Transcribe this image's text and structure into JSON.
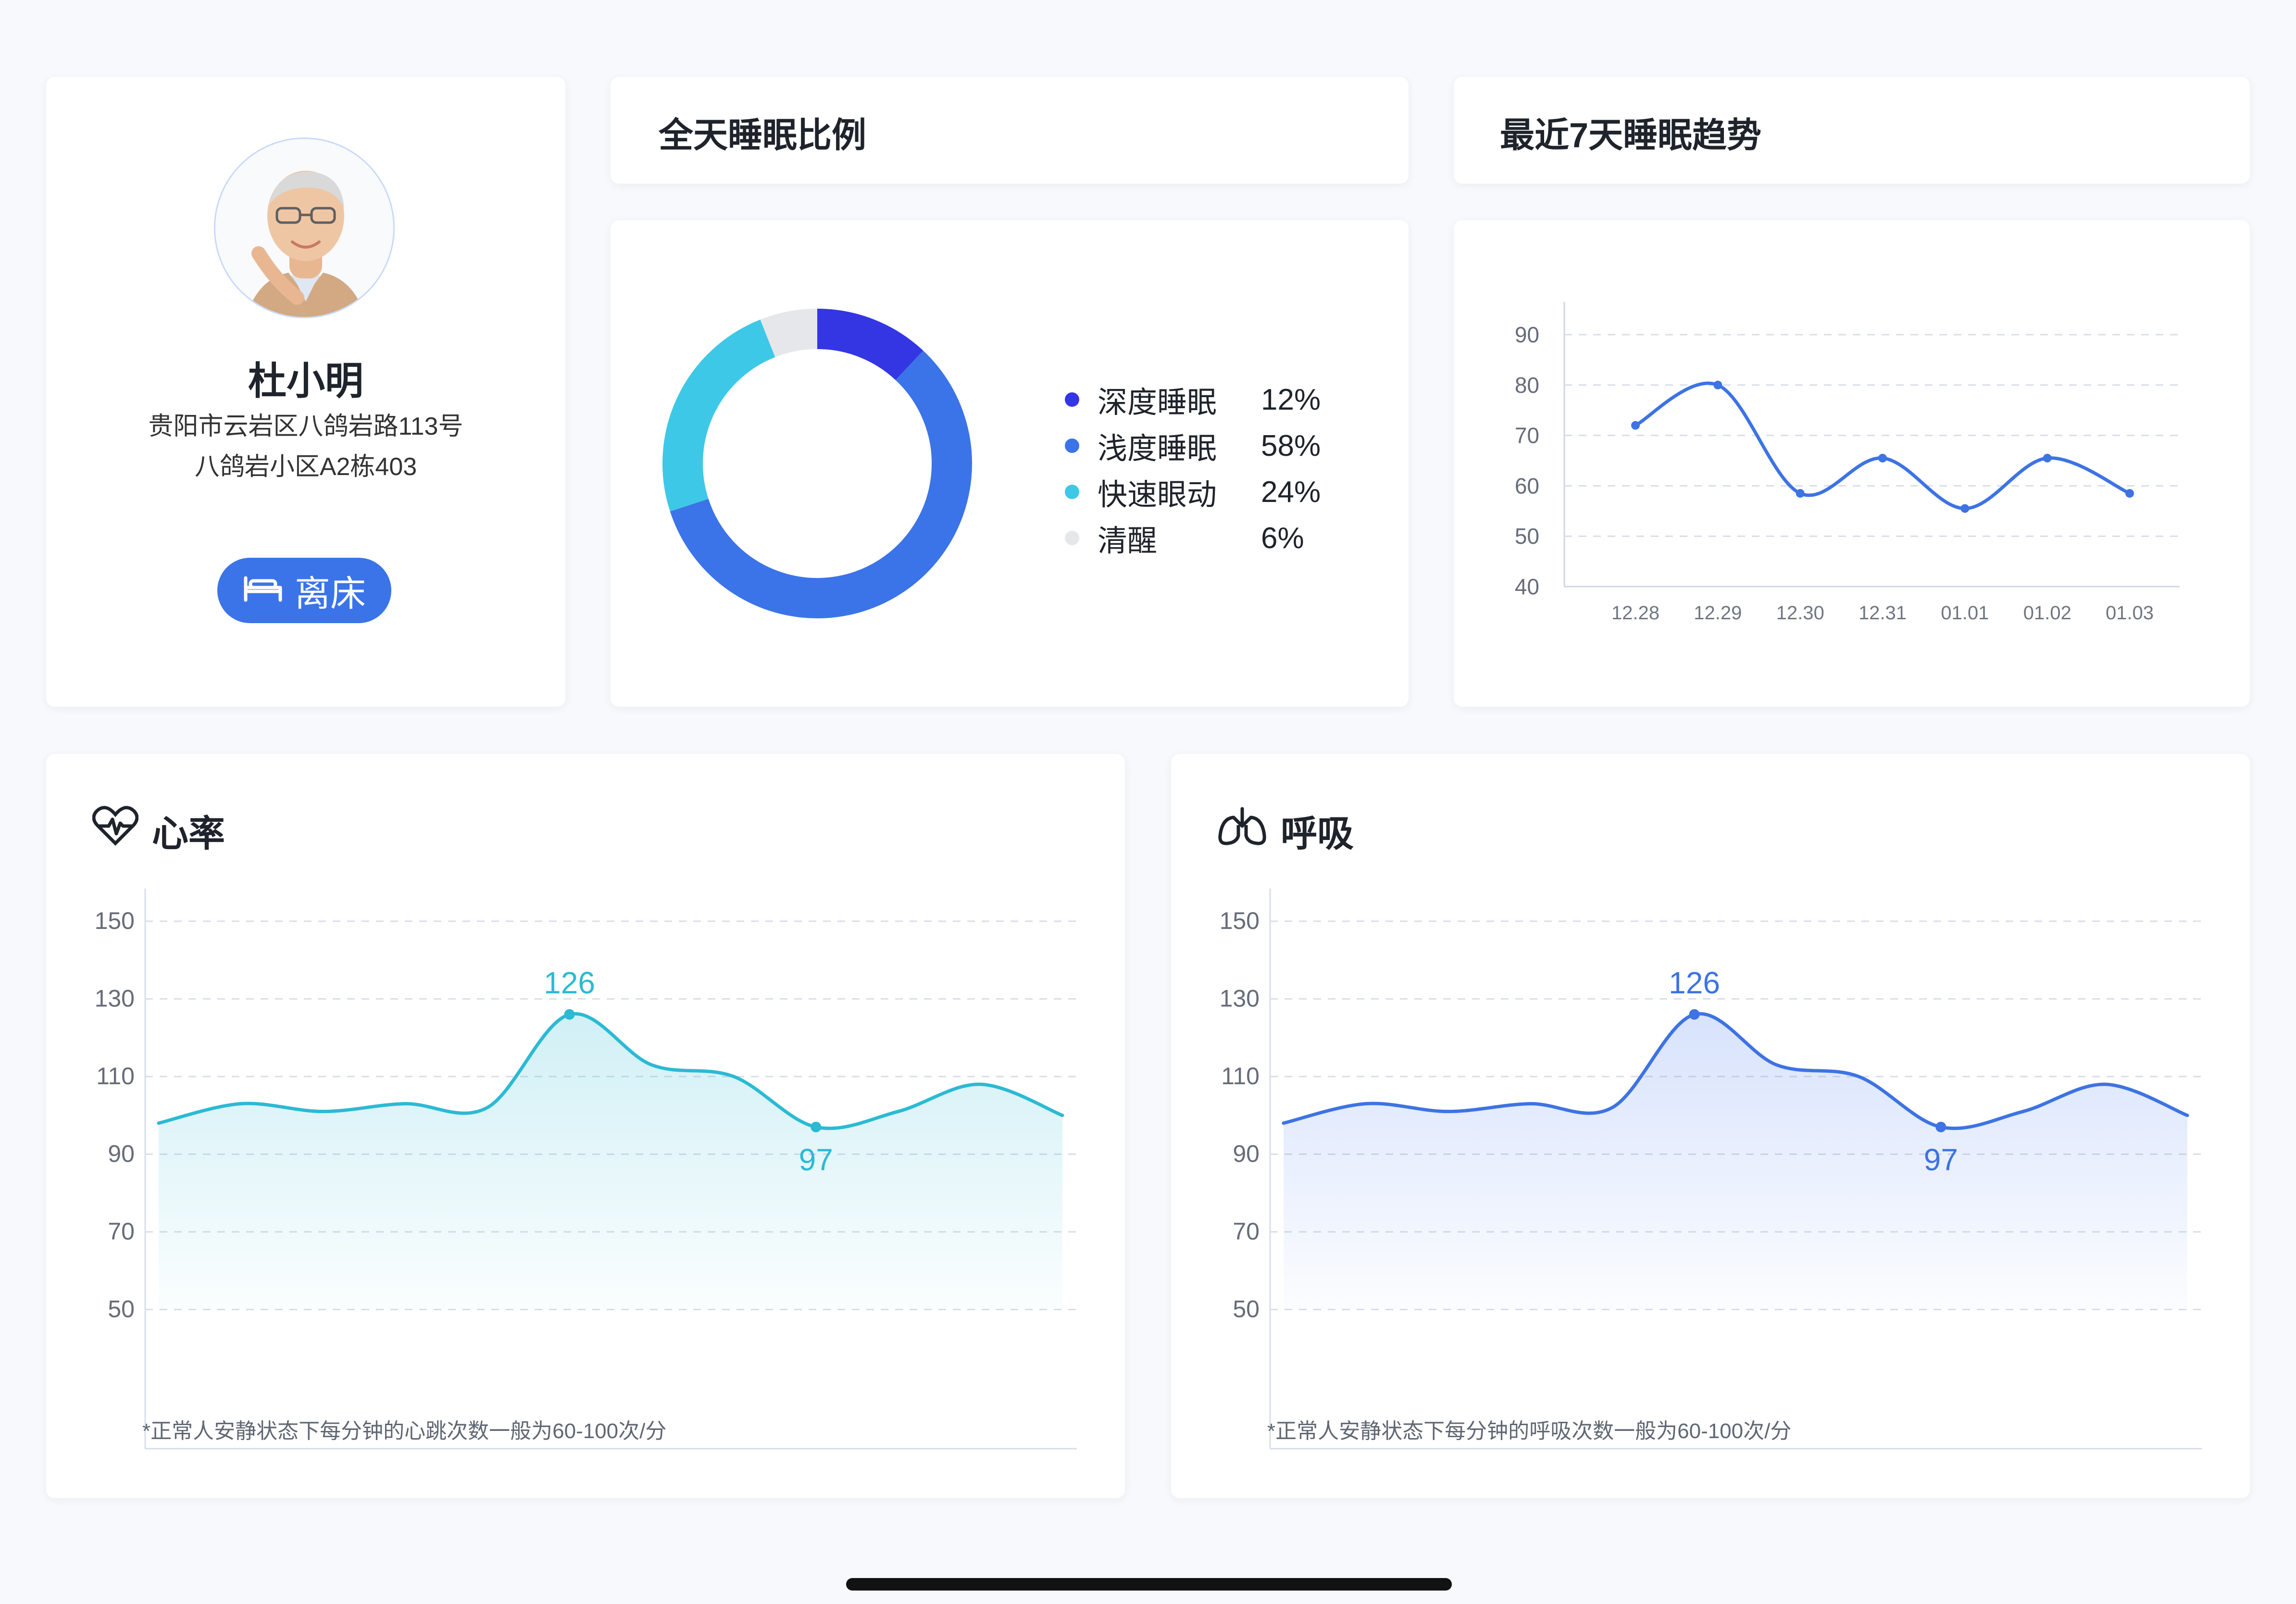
{
  "profile": {
    "name": "杜小明",
    "address_line1": "贵阳市云岩区八鸽岩路113号",
    "address_line2": "八鸽岩小区A2栋403",
    "status_label": "离床"
  },
  "sleep_ratio_panel": {
    "title": "全天睡眠比例"
  },
  "sleep_trend_panel": {
    "title": "最近7天睡眠趋势"
  },
  "heart_rate_panel": {
    "title": "心率",
    "footnote": "*正常人安静状态下每分钟的心跳次数一般为60-100次/分"
  },
  "breathing_panel": {
    "title": "呼吸",
    "footnote": "*正常人安静状态下每分钟的呼吸次数一般为60-100次/分"
  },
  "colors": {
    "background": "#f7f9fc",
    "card": "#ffffff",
    "deep_sleep": "#3436e4",
    "light_sleep": "#3b74e8",
    "rem": "#3ec8e7",
    "awake": "#e5e7eb",
    "heart_line": "#2bbad4",
    "breath_line": "#3d73e3",
    "button": "#3b74e8"
  },
  "chart_data": [
    {
      "type": "pie",
      "variant": "donut",
      "title": "全天睡眠比例",
      "categories": [
        "深度睡眠",
        "浅度睡眠",
        "快速眼动",
        "清醒"
      ],
      "values": [
        12,
        58,
        24,
        6
      ],
      "value_labels": [
        "12%",
        "58%",
        "24%",
        "6%"
      ],
      "colors": [
        "#3436e4",
        "#3b74e8",
        "#3ec8e7",
        "#e5e7eb"
      ],
      "legend_position": "right"
    },
    {
      "type": "line",
      "title": "最近7天睡眠趋势",
      "x": [
        "12.28",
        "12.29",
        "12.30",
        "12.31",
        "01.01",
        "01.02",
        "01.03"
      ],
      "yticks": [
        40,
        50,
        60,
        70,
        80,
        90
      ],
      "ylim": [
        40,
        90
      ],
      "series": [
        {
          "values": [
            72,
            80,
            58.5,
            65.5,
            55.5,
            65.5,
            58.5
          ]
        }
      ],
      "grid": true
    },
    {
      "type": "area",
      "title": "心率",
      "yticks": [
        50,
        70,
        90,
        110,
        130,
        150
      ],
      "ylim": [
        30,
        150
      ],
      "series": [
        {
          "values": [
            98,
            103,
            101,
            103,
            102,
            126,
            113,
            110,
            97,
            101,
            108,
            100
          ]
        }
      ],
      "labels": [
        {
          "index": 5,
          "text": "126"
        },
        {
          "index": 8,
          "text": "97"
        }
      ],
      "grid": true
    },
    {
      "type": "area",
      "title": "呼吸",
      "yticks": [
        50,
        70,
        90,
        110,
        130,
        150
      ],
      "ylim": [
        30,
        150
      ],
      "series": [
        {
          "values": [
            98,
            103,
            101,
            103,
            102,
            126,
            113,
            110,
            97,
            101,
            108,
            100
          ]
        }
      ],
      "labels": [
        {
          "index": 5,
          "text": "126"
        },
        {
          "index": 8,
          "text": "97"
        }
      ],
      "grid": true
    }
  ]
}
